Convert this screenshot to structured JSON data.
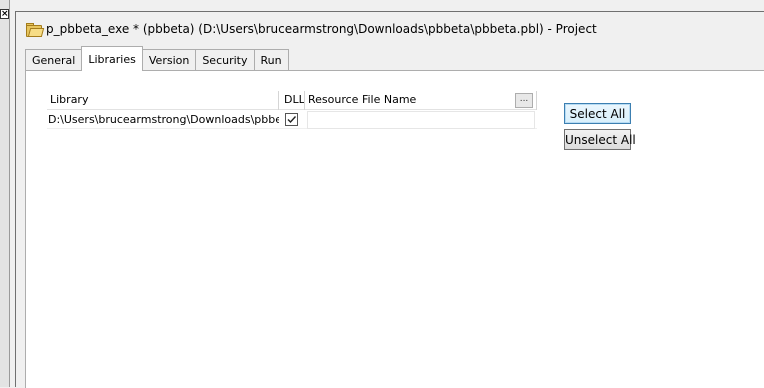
{
  "window": {
    "title": "p_pbbeta_exe * (pbbeta) (D:\\Users\\brucearmstrong\\Downloads\\pbbeta\\pbbeta.pbl) - Project",
    "icon": "folder-open-icon"
  },
  "tabs": [
    {
      "label": "General",
      "active": false
    },
    {
      "label": "Libraries",
      "active": true
    },
    {
      "label": "Version",
      "active": false
    },
    {
      "label": "Security",
      "active": false
    },
    {
      "label": "Run",
      "active": false
    }
  ],
  "libraries_table": {
    "columns": [
      "Library",
      "DLL",
      "Resource File Name"
    ],
    "rows": [
      {
        "library": "D:\\Users\\brucearmstrong\\Downloads\\pbbeta\\p",
        "dll": true,
        "resource_file_name": ""
      }
    ],
    "browse_label": "..."
  },
  "buttons": {
    "select_all": "Select All",
    "unselect_all": "Unselect All"
  }
}
